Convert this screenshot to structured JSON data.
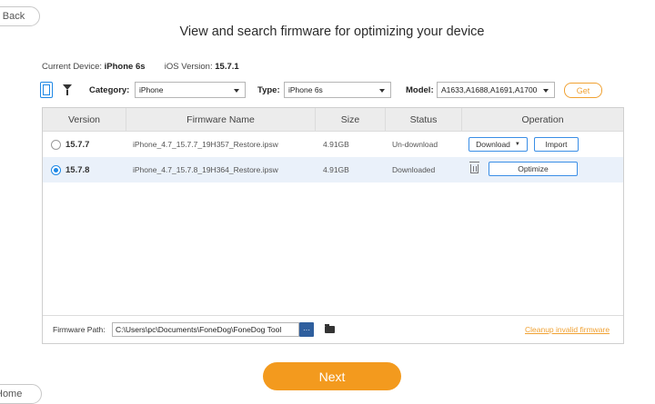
{
  "nav": {
    "back_label": "Back",
    "home_label": "Home"
  },
  "title": "View and search firmware for optimizing your device",
  "device": {
    "current_label": "Current Device:",
    "current_value": "iPhone 6s",
    "ios_label": "iOS Version:",
    "ios_value": "15.7.1"
  },
  "filters": {
    "category_label": "Category:",
    "category_value": "iPhone",
    "type_label": "Type:",
    "type_value": "iPhone 6s",
    "model_label": "Model:",
    "model_value": "A1633,A1688,A1691,A1700",
    "get_label": "Get"
  },
  "table": {
    "columns": [
      "Version",
      "Firmware Name",
      "Size",
      "Status",
      "Operation"
    ],
    "rows": [
      {
        "version": "15.7.7",
        "name": "iPhone_4.7_15.7.7_19H357_Restore.ipsw",
        "size": "4.91GB",
        "status": "Un-download",
        "download_label": "Download",
        "import_label": "Import",
        "selected": false
      },
      {
        "version": "15.7.8",
        "name": "iPhone_4.7_15.7.8_19H364_Restore.ipsw",
        "size": "4.91GB",
        "status": "Downloaded",
        "optimize_label": "Optimize",
        "selected": true
      }
    ]
  },
  "firmware_path": {
    "label": "Firmware Path:",
    "value": "C:\\Users\\pc\\Documents\\FoneDog\\FoneDog Tool",
    "browse_label": "···",
    "cleanup_label": "Cleanup invalid firmware"
  },
  "next_label": "Next",
  "colors": {
    "accent": "#f39a1e",
    "link": "#f0a132",
    "blue": "#1e88e5",
    "selected_row": "#eaf1fa"
  }
}
